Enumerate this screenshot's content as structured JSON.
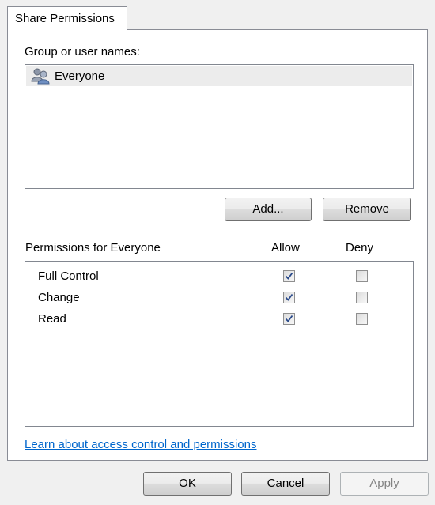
{
  "tab": {
    "label": "Share Permissions"
  },
  "users": {
    "heading": "Group or user names:",
    "items": [
      {
        "name": "Everyone",
        "icon": "users-icon"
      }
    ],
    "add_label": "Add...",
    "remove_label": "Remove"
  },
  "permissions": {
    "heading": "Permissions for Everyone",
    "allow_label": "Allow",
    "deny_label": "Deny",
    "rows": [
      {
        "name": "Full Control",
        "allow": true,
        "deny": false
      },
      {
        "name": "Change",
        "allow": true,
        "deny": false
      },
      {
        "name": "Read",
        "allow": true,
        "deny": false
      }
    ]
  },
  "link": {
    "label": "Learn about access control and permissions"
  },
  "footer": {
    "ok_label": "OK",
    "cancel_label": "Cancel",
    "apply_label": "Apply",
    "apply_enabled": false
  }
}
